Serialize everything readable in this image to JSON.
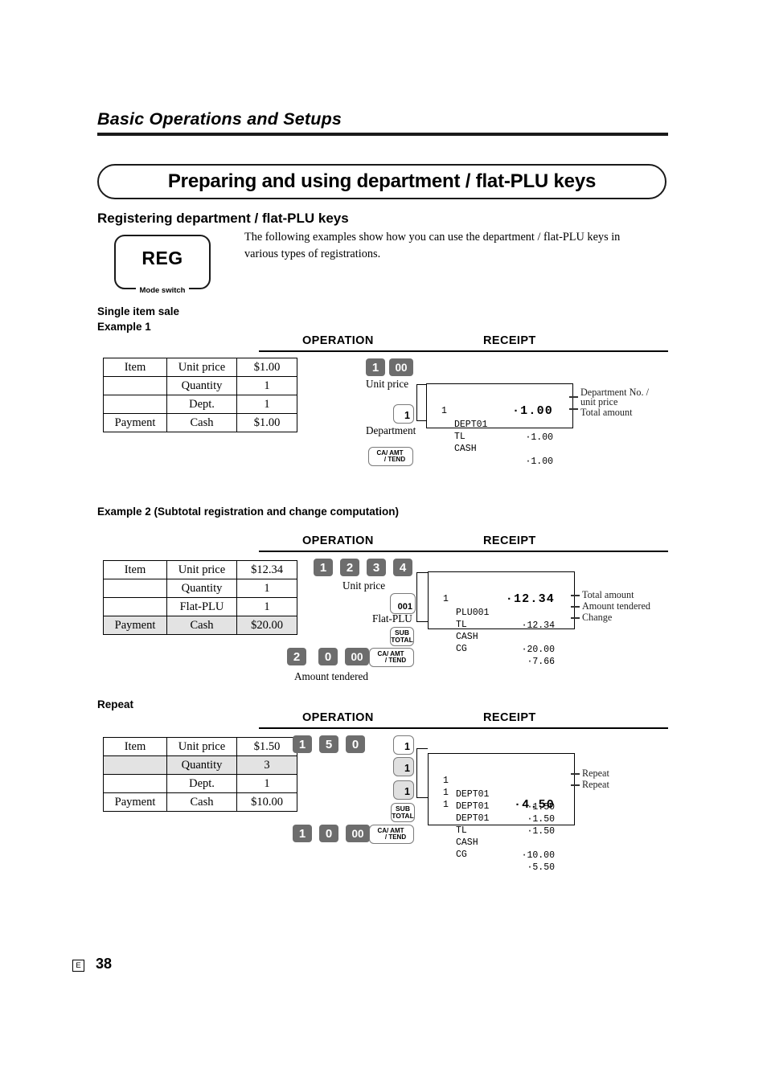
{
  "page": {
    "running_head": "Basic Operations and Setups",
    "title": "Preparing and using department / flat-PLU keys",
    "section_heading": "Registering department / flat-PLU keys",
    "intro": "The following examples show how you can use the department / flat-PLU keys in various types of registrations.",
    "footer_lang": "E",
    "footer_page": "38"
  },
  "mode_switch": {
    "label": "REG",
    "caption": "Mode switch"
  },
  "column_headers": {
    "operation": "OPERATION",
    "receipt": "RECEIPT"
  },
  "examples": [
    {
      "id": "single-item-sale",
      "heading_line1": "Single item sale",
      "heading_line2": "Example 1",
      "table": {
        "rows": [
          {
            "label": "Item",
            "field": "Unit price",
            "value": "$1.00",
            "highlight": false
          },
          {
            "label": "",
            "field": "Quantity",
            "value": "1",
            "highlight": false
          },
          {
            "label": "",
            "field": "Dept.",
            "value": "1",
            "highlight": false
          },
          {
            "label": "Payment",
            "field": "Cash",
            "value": "$1.00",
            "highlight": false
          }
        ]
      },
      "operation": {
        "price_keys": [
          "1",
          "00"
        ],
        "price_caption": "Unit price",
        "dept_key": "1",
        "dept_caption": "Department",
        "cash_key_line1": "CA/ AMT",
        "cash_key_line2": "/ TEND"
      },
      "receipt": {
        "lines": [
          {
            "qty": "1",
            "name": "DEPT01",
            "amount": "·1.00",
            "big": false
          },
          {
            "qty": "",
            "name": "TL",
            "amount": "·1.00",
            "big": true
          },
          {
            "qty": "",
            "name": "CASH",
            "amount": "·1.00",
            "big": false
          }
        ],
        "annotations": [
          "Department No. /",
          "unit price",
          "Total amount"
        ]
      }
    },
    {
      "id": "subtotal-change",
      "heading_line1": "Example 2 (Subtotal registration and change computation)",
      "heading_line2": "",
      "table": {
        "rows": [
          {
            "label": "Item",
            "field": "Unit price",
            "value": "$12.34",
            "highlight": false
          },
          {
            "label": "",
            "field": "Quantity",
            "value": "1",
            "highlight": false
          },
          {
            "label": "",
            "field": "Flat-PLU",
            "value": "1",
            "highlight": false
          },
          {
            "label": "Payment",
            "field": "Cash",
            "value": "$20.00",
            "highlight": true
          }
        ]
      },
      "operation": {
        "price_keys": [
          "1",
          "2",
          "3",
          "4"
        ],
        "price_caption": "Unit price",
        "plu_key": "001",
        "plu_caption": "Flat-PLU",
        "subtotal_key_line1": "SUB",
        "subtotal_key_line2": "TOTAL",
        "tender_keys": [
          "2",
          "0",
          "00"
        ],
        "tender_caption": "Amount tendered",
        "cash_key_line1": "CA/ AMT",
        "cash_key_line2": "/ TEND"
      },
      "receipt": {
        "lines": [
          {
            "qty": "1",
            "name": "PLU001",
            "amount": "·12.34",
            "big": false
          },
          {
            "qty": "",
            "name": "TL",
            "amount": "·12.34",
            "big": true
          },
          {
            "qty": "",
            "name": "CASH",
            "amount": "·20.00",
            "big": false
          },
          {
            "qty": "",
            "name": "CG",
            "amount": "·7.66",
            "big": false
          }
        ],
        "annotations": [
          "Total amount",
          "Amount tendered",
          "Change"
        ]
      }
    },
    {
      "id": "repeat",
      "heading_line1": "Repeat",
      "heading_line2": "",
      "table": {
        "rows": [
          {
            "label": "Item",
            "field": "Unit price",
            "value": "$1.50",
            "highlight": false
          },
          {
            "label": "",
            "field": "Quantity",
            "value": "3",
            "highlight": true
          },
          {
            "label": "",
            "field": "Dept.",
            "value": "1",
            "highlight": false
          },
          {
            "label": "Payment",
            "field": "Cash",
            "value": "$10.00",
            "highlight": false
          }
        ]
      },
      "operation": {
        "price_keys": [
          "1",
          "5",
          "0"
        ],
        "dept_keys": [
          "1",
          "1",
          "1"
        ],
        "subtotal_key_line1": "SUB",
        "subtotal_key_line2": "TOTAL",
        "tender_keys": [
          "1",
          "0",
          "00"
        ],
        "cash_key_line1": "CA/ AMT",
        "cash_key_line2": "/ TEND"
      },
      "receipt": {
        "lines": [
          {
            "qty": "1",
            "name": "DEPT01",
            "amount": "·1.50",
            "big": false
          },
          {
            "qty": "1",
            "name": "DEPT01",
            "amount": "·1.50",
            "big": false
          },
          {
            "qty": "1",
            "name": "DEPT01",
            "amount": "·1.50",
            "big": false
          },
          {
            "qty": "",
            "name": "TL",
            "amount": "·4.50",
            "big": true
          },
          {
            "qty": "",
            "name": "CASH",
            "amount": "·10.00",
            "big": false
          },
          {
            "qty": "",
            "name": "CG",
            "amount": "·5.50",
            "big": false
          }
        ],
        "annotations": [
          "Repeat",
          "Repeat"
        ]
      }
    }
  ]
}
